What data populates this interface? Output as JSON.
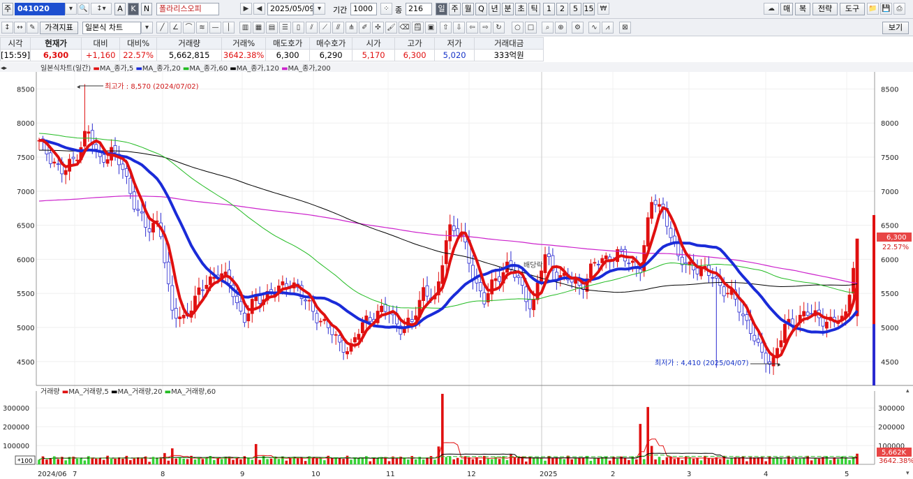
{
  "toolbar": {
    "market_label": "주",
    "code": "041020",
    "name": "폴라리스오피",
    "date": "2025/05/09",
    "period_label": "기간",
    "period_value": "1000",
    "count_label": "종",
    "count_value": "216",
    "a_label": "A",
    "k_label": "K",
    "n_label": "N",
    "periods": [
      "일",
      "주",
      "월",
      "Q",
      "년",
      "분",
      "초",
      "틱",
      "1",
      "2",
      "5",
      "15"
    ],
    "right_buttons": [
      "매",
      "복",
      "전략",
      "도구"
    ],
    "indicator_label": "가격지표",
    "chart_type": "일본식 차트",
    "view_button": "보기"
  },
  "quote": {
    "headers": [
      "시각",
      "현재가",
      "대비",
      "대비%",
      "거래량",
      "거래%",
      "매도호가",
      "매수호가",
      "시가",
      "고가",
      "저가",
      "거래대금"
    ],
    "values": [
      "[15:59]",
      "6,300",
      "+1,160",
      "22.57%",
      "5,662,815",
      "3642.38%",
      "6,300",
      "6,290",
      "5,170",
      "6,300",
      "5,020",
      "333억원"
    ]
  },
  "price_legend": {
    "title": "일본식차트(일간)",
    "items": [
      {
        "label": "MA_종가,5",
        "color": "#e01010"
      },
      {
        "label": "MA_종가,20",
        "color": "#1a2bd8"
      },
      {
        "label": "MA_종가,60",
        "color": "#22bb22"
      },
      {
        "label": "MA_종가,120",
        "color": "#000000"
      },
      {
        "label": "MA_종가,200",
        "color": "#cc22cc"
      }
    ]
  },
  "volume_legend": {
    "title": "거래량",
    "items": [
      {
        "label": "MA_거래량,5",
        "color": "#e01010"
      },
      {
        "label": "MA_거래량,20",
        "color": "#000000"
      },
      {
        "label": "MA_거래량,60",
        "color": "#22bb22"
      }
    ]
  },
  "annotations": {
    "high": "최고가 : 8,570 (2024/07/02)",
    "low": "최저가 : 4,410 (2025/04/07)",
    "dividend": "배당락",
    "price_badge": "6,300",
    "pct_badge": "22.57%",
    "vol_badge": "5,662K",
    "vol_pct": "3642.38%",
    "vol_unit": "*100"
  },
  "chart_data": {
    "type": "candlestick",
    "x_range": [
      "2024/06",
      "2025/05/09"
    ],
    "month_labels": [
      "2024/06",
      "7",
      "8",
      "9",
      "10",
      "11",
      "12",
      "2025",
      "2",
      "3",
      "4",
      "5"
    ],
    "price_axis": {
      "range": [
        4150,
        8750
      ],
      "ticks": [
        4500,
        5000,
        5500,
        6000,
        6500,
        7000,
        7500,
        8000,
        8500
      ]
    },
    "volume_axis": {
      "range": [
        0,
        390000
      ],
      "ticks": [
        100000,
        200000,
        300000
      ]
    },
    "high": {
      "value": 8570,
      "date": "2024/07/02"
    },
    "low": {
      "value": 4410,
      "date": "2025/04/07"
    },
    "last": {
      "open": 5170,
      "high": 6300,
      "low": 5020,
      "close": 6300
    },
    "close_path": [
      [
        "2024/06",
        7700
      ],
      [
        "2024/06",
        7500
      ],
      [
        "2024/06",
        7250
      ],
      [
        "2024/07",
        7500
      ],
      [
        "2024/07",
        7900
      ],
      [
        "2024/07",
        7450
      ],
      [
        "2024/07",
        7600
      ],
      [
        "2024/07",
        7300
      ],
      [
        "2024/07",
        6800
      ],
      [
        "2024/07",
        6400
      ],
      [
        "2024/08",
        6600
      ],
      [
        "2024/08",
        5200
      ],
      [
        "2024/08",
        5150
      ],
      [
        "2024/08",
        5400
      ],
      [
        "2024/08",
        5700
      ],
      [
        "2024/08",
        5800
      ],
      [
        "2024/09",
        5600
      ],
      [
        "2024/09",
        5100
      ],
      [
        "2024/09",
        5400
      ],
      [
        "2024/09",
        5500
      ],
      [
        "2024/09",
        5550
      ],
      [
        "2024/10",
        5700
      ],
      [
        "2024/10",
        5400
      ],
      [
        "2024/10",
        5200
      ],
      [
        "2024/10",
        5000
      ],
      [
        "2024/10",
        4750
      ],
      [
        "2024/11",
        4700
      ],
      [
        "2024/11",
        5100
      ],
      [
        "2024/11",
        5200
      ],
      [
        "2024/11",
        5250
      ],
      [
        "2024/11",
        5000
      ],
      [
        "2024/11",
        5050
      ],
      [
        "2024/11",
        5600
      ],
      [
        "2024/11",
        5350
      ],
      [
        "2024/11",
        6500
      ],
      [
        "2024/12",
        6400
      ],
      [
        "2024/12",
        5800
      ],
      [
        "2024/12",
        5400
      ],
      [
        "2024/12",
        5700
      ],
      [
        "2024/12",
        5950
      ],
      [
        "2024/12",
        5600
      ],
      [
        "2024/12",
        5300
      ],
      [
        "2025/01",
        6050
      ],
      [
        "2025/01",
        5800
      ],
      [
        "2025/01",
        5700
      ],
      [
        "2025/01",
        5600
      ],
      [
        "2025/01",
        5900
      ],
      [
        "2025/01",
        6000
      ],
      [
        "2025/02",
        6100
      ],
      [
        "2025/02",
        5950
      ],
      [
        "2025/02",
        5900
      ],
      [
        "2025/02",
        6900
      ],
      [
        "2025/02",
        6700
      ],
      [
        "2025/03",
        6000
      ],
      [
        "2025/03",
        5950
      ],
      [
        "2025/03",
        5800
      ],
      [
        "2025/03",
        5800
      ],
      [
        "2025/03",
        5500
      ],
      [
        "2025/03",
        5400
      ],
      [
        "2025/04",
        5000
      ],
      [
        "2025/04",
        4600
      ],
      [
        "2025/04",
        4500
      ],
      [
        "2025/04",
        5000
      ],
      [
        "2025/04",
        5150
      ],
      [
        "2025/04",
        5200
      ],
      [
        "2025/04",
        5150
      ],
      [
        "2025/05",
        5050
      ],
      [
        "2025/05",
        5150
      ],
      [
        "2025/05",
        6300
      ]
    ],
    "series": [
      {
        "name": "MA_종가,5",
        "color": "#e01010"
      },
      {
        "name": "MA_종가,20",
        "color": "#1a2bd8"
      },
      {
        "name": "MA_종가,60",
        "color": "#22bb22"
      },
      {
        "name": "MA_종가,120",
        "color": "#000000"
      },
      {
        "name": "MA_종가,200",
        "color": "#cc22cc"
      }
    ],
    "volume_series": [
      {
        "name": "MA_거래량,5",
        "color": "#e01010"
      },
      {
        "name": "MA_거래량,20",
        "color": "#000000"
      },
      {
        "name": "MA_거래량,60",
        "color": "#22bb22"
      }
    ],
    "volume_spikes": [
      {
        "date": "2024/11",
        "value": 375000
      },
      {
        "date": "2025/02",
        "value": 305000
      },
      {
        "date": "2025/02",
        "value": 215000
      },
      {
        "date": "2024/08",
        "value": 85000
      },
      {
        "date": "2024/09",
        "value": 108000
      },
      {
        "date": "2025/05",
        "value": 56628
      }
    ]
  }
}
